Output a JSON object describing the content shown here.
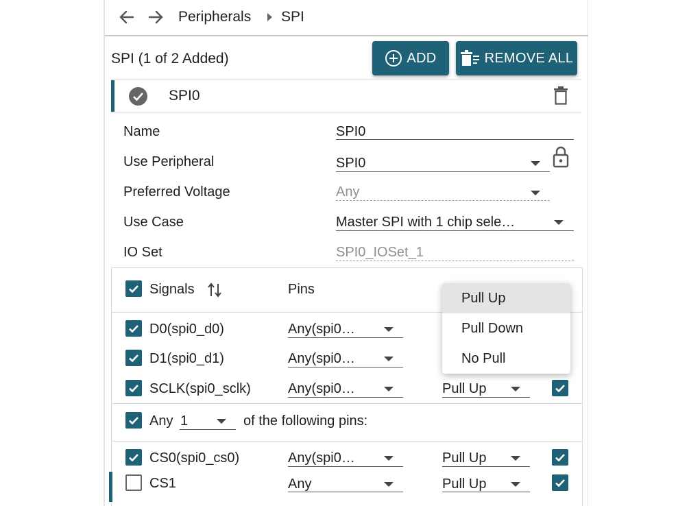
{
  "breadcrumb": {
    "parent": "Peripherals",
    "current": "SPI"
  },
  "header": {
    "title": "SPI (1 of 2 Added)",
    "add_label": "ADD",
    "remove_all_label": "REMOVE ALL"
  },
  "instance": {
    "name": "SPI0"
  },
  "config": {
    "name_label": "Name",
    "name_value": "SPI0",
    "use_peripheral_label": "Use Peripheral",
    "use_peripheral_value": "SPI0",
    "preferred_voltage_label": "Preferred Voltage",
    "preferred_voltage_value": "Any",
    "use_case_label": "Use Case",
    "use_case_value": "Master SPI with 1 chip sele…",
    "io_set_label": "IO Set",
    "io_set_value": "SPI0_IOSet_1"
  },
  "signals": {
    "header_signals": "Signals",
    "header_pins": "Pins",
    "rows": [
      {
        "name": "D0(spi0_d0)",
        "pin": "Any(spi0…",
        "checked": true
      },
      {
        "name": "D1(spi0_d1)",
        "pin": "Any(spi0…",
        "checked": true
      },
      {
        "name": "SCLK(spi0_sclk)",
        "pin": "Any(spi0…",
        "pull": "Pull Up",
        "checked": true
      }
    ],
    "any_group": {
      "label_any": "Any",
      "count": "1",
      "label_suffix": "of the following pins:"
    },
    "cs_rows": [
      {
        "name": "CS0(spi0_cs0)",
        "pin": "Any(spi0…",
        "pull": "Pull Up",
        "checked": true
      },
      {
        "name": "CS1",
        "pin": "Any",
        "pull": "Pull Up",
        "checked": false
      }
    ]
  },
  "pull_menu": {
    "options": [
      "Pull Up",
      "Pull Down",
      "No Pull"
    ],
    "selected": "Pull Up"
  },
  "colors": {
    "accent": "#1f6177",
    "divider": "#d8d8d8"
  }
}
